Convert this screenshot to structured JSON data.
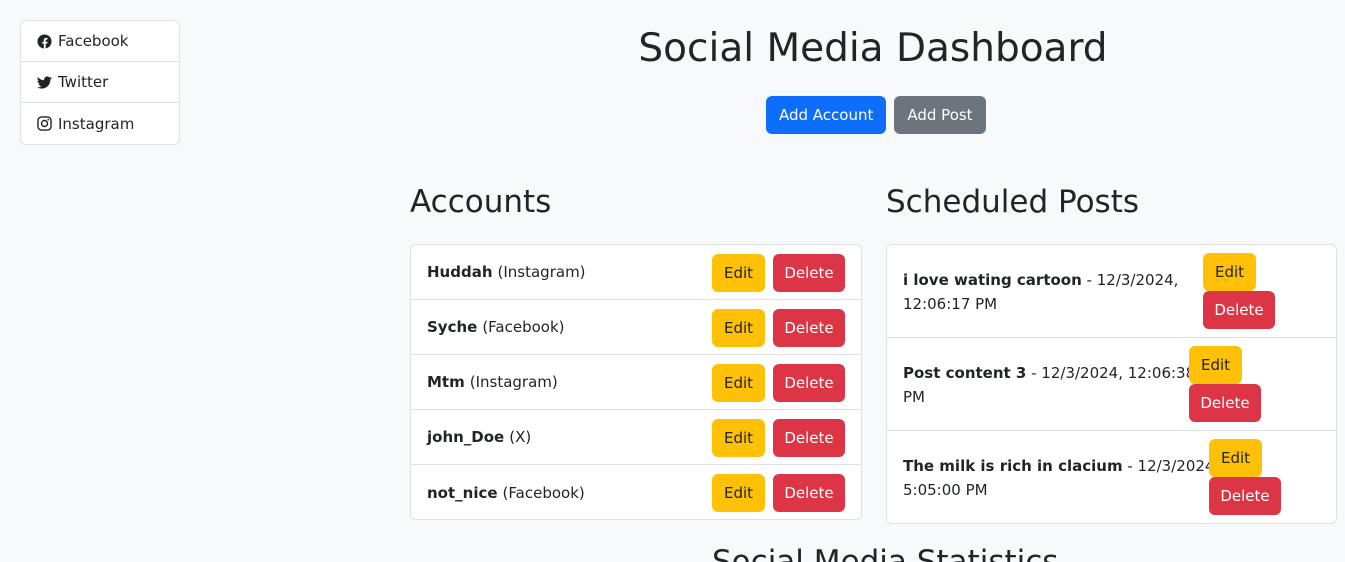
{
  "sidebar": {
    "items": [
      {
        "label": "Facebook",
        "icon": "facebook-icon"
      },
      {
        "label": "Twitter",
        "icon": "twitter-icon"
      },
      {
        "label": "Instagram",
        "icon": "instagram-icon"
      }
    ]
  },
  "header": {
    "title": "Social Media Dashboard",
    "add_account_label": "Add Account",
    "add_post_label": "Add Post"
  },
  "accounts": {
    "heading": "Accounts",
    "edit_label": "Edit",
    "delete_label": "Delete",
    "items": [
      {
        "name": "Huddah",
        "platform": "(Instagram)"
      },
      {
        "name": "Syche",
        "platform": "(Facebook)"
      },
      {
        "name": "Mtm",
        "platform": "(Instagram)"
      },
      {
        "name": "john_Doe",
        "platform": "(X)"
      },
      {
        "name": "not_nice",
        "platform": "(Facebook)"
      }
    ]
  },
  "posts": {
    "heading": "Scheduled Posts",
    "edit_label": "Edit",
    "delete_label": "Delete",
    "items": [
      {
        "content": "i love wating cartoon",
        "line1": " - 12/3/2024,",
        "line2": "12:06:17 PM"
      },
      {
        "content": "Post content 3",
        "line1": " - 12/3/2024, 12:06:38",
        "line2": "PM"
      },
      {
        "content": "The milk is rich in clacium",
        "line1": " - 12/3/2024,",
        "line2": "5:05:00 PM"
      }
    ]
  },
  "stats": {
    "heading": "Social Media Statistics"
  },
  "colors": {
    "primary": "#0d6efd",
    "secondary": "#6c757d",
    "warning": "#ffc107",
    "danger": "#dc3545"
  }
}
